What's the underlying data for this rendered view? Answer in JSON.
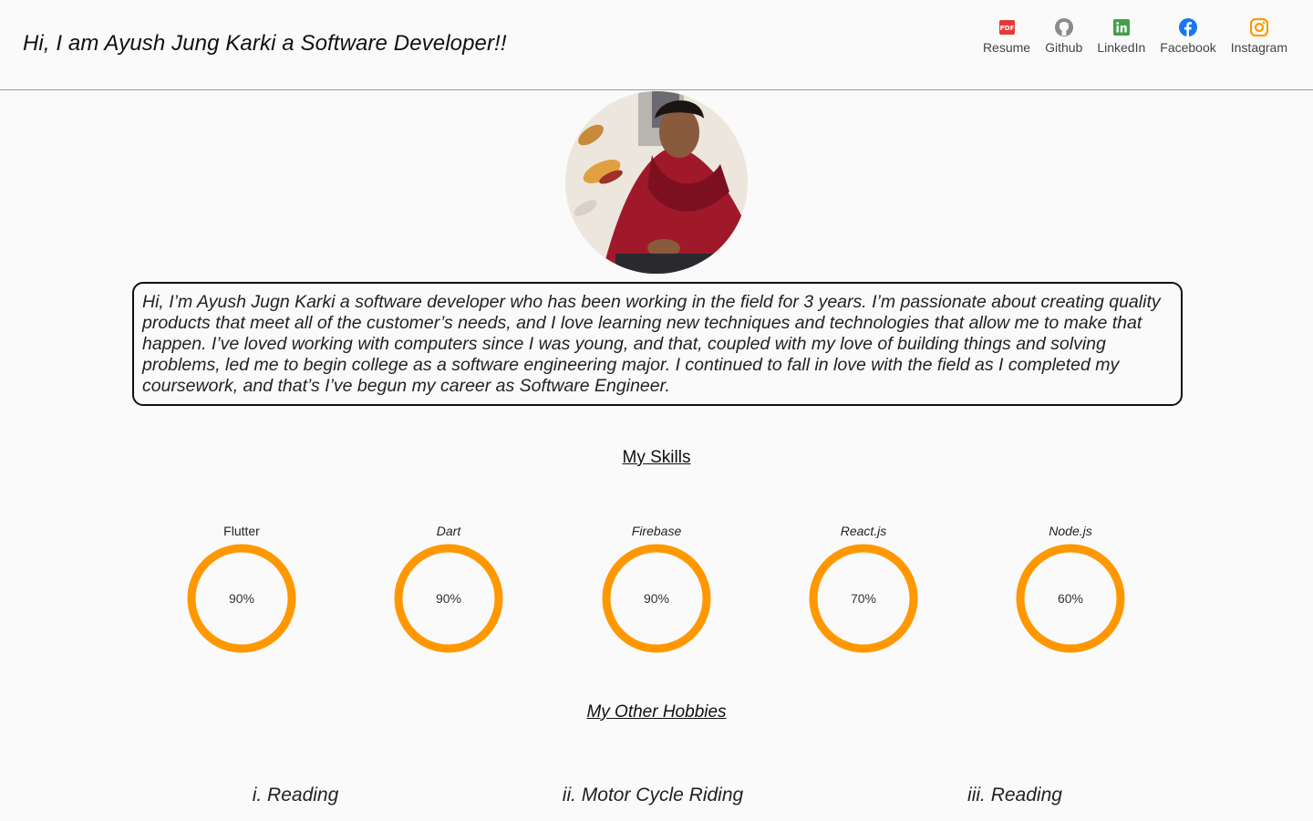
{
  "header": {
    "title": "Hi, I am Ayush Jung Karki a Software Developer!!",
    "nav": [
      {
        "label": "Resume",
        "icon": "pdf-icon",
        "color": "#e53935"
      },
      {
        "label": "Github",
        "icon": "github-icon",
        "color": "#888888"
      },
      {
        "label": "LinkedIn",
        "icon": "linkedin-icon",
        "color": "#43a047"
      },
      {
        "label": "Facebook",
        "icon": "facebook-icon",
        "color": "#1877f2"
      },
      {
        "label": "Instagram",
        "icon": "instagram-icon",
        "color": "#ff9800"
      }
    ]
  },
  "bio": {
    "text": "Hi, I’m Ayush Jugn Karki a software developer who has been working in the field for 3 years. I’m passionate about creating quality products that meet all of the customer’s needs, and I love learning new techniques and technologies that allow me to make that happen. I’ve loved working with computers since I was young, and that, coupled with my love of building things and solving problems, led me to begin college as a software engineering major. I continued to fall in love with the field as I completed my coursework, and that’s  I’ve begun my career as Software Engineer."
  },
  "skills": {
    "title": "My Skills",
    "ring_color": "#ff9800",
    "items": [
      {
        "name": "Flutter",
        "value_label": "90%",
        "value": 0.9
      },
      {
        "name": "Dart",
        "value_label": "90%",
        "value": 0.9
      },
      {
        "name": "Firebase",
        "value_label": "90%",
        "value": 0.9
      },
      {
        "name": "React.js",
        "value_label": "70%",
        "value": 0.7
      },
      {
        "name": "Node.js",
        "value_label": "60%",
        "value": 0.6
      }
    ]
  },
  "hobbies": {
    "title": "My Other Hobbies",
    "items": [
      "i. Reading",
      "ii. Motor Cycle Riding",
      "iii. Reading"
    ]
  }
}
